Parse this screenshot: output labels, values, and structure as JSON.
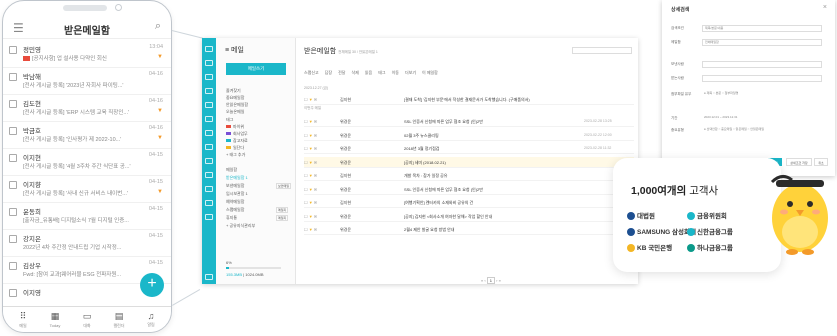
{
  "phone": {
    "title": "받은메일함",
    "menu_icon": "menu-icon",
    "items": [
      {
        "name": "정민영",
        "date": "13:04",
        "subject": "[공지사항] 업 설사용 다약인 회신",
        "flag": "red"
      },
      {
        "name": "박남해",
        "date": "04-16",
        "subject": "[전사 게시글 등록] '2023년 자회사 파이팅...'",
        "flag": "none"
      },
      {
        "name": "김도현",
        "date": "04-16",
        "subject": "[전사 게시글 등록] 'ERP 시스템 교육 직장인...'",
        "flag": "orange"
      },
      {
        "name": "박금호",
        "date": "04-16",
        "subject": "[전사 게시글 등록] '인사평가 제 2022-10...'",
        "flag": "orange"
      },
      {
        "name": "이지현",
        "date": "04-15",
        "subject": "[전사 게시글 등록] '4월 3주차 주간 식단표 공...'",
        "flag": "none"
      },
      {
        "name": "이지향",
        "date": "04-15",
        "subject": "[전사 게시글 등록] '사내 신규 서비스 내이번...'",
        "flag": "orange"
      },
      {
        "name": "윤동희",
        "date": "04-15",
        "subject": "[출자금_유통배] 디지털소식 7월 디지털 인증...",
        "flag": "none"
      },
      {
        "name": "강지은",
        "date": "04-15",
        "subject": "2022년 4차 주간정 안내드립 기업 시작정...",
        "flag": "none"
      },
      {
        "name": "김상우",
        "date": "04-15",
        "subject": "Fwd: [참여 교과]웨어러블 ESG 전파자원...",
        "flag": "none"
      },
      {
        "name": "이지영",
        "date": "04-15",
        "subject": "",
        "flag": "none"
      }
    ],
    "nav": [
      {
        "label": "메일",
        "icon": "grid-icon",
        "glyph": "⠿"
      },
      {
        "label": "Today",
        "icon": "calendar-icon",
        "glyph": "▦"
      },
      {
        "label": "대화",
        "icon": "chat-icon",
        "glyph": "▭"
      },
      {
        "label": "캘린더",
        "icon": "calendar-icon",
        "glyph": "▤"
      },
      {
        "label": "알림",
        "icon": "bell-icon",
        "glyph": "♫"
      }
    ],
    "fab_label": "+"
  },
  "desktop": {
    "app_title": "메일",
    "write_button": "메일쓰기",
    "folders": [
      {
        "label": "즐겨찾기",
        "color": ""
      },
      {
        "label": "중요메일함",
        "color": ""
      },
      {
        "label": "안읽은메일함",
        "color": ""
      },
      {
        "label": "오늘온메일",
        "color": ""
      },
      {
        "label": "태그",
        "color": ""
      },
      {
        "label": "마이위",
        "color": "#e84b3c"
      },
      {
        "label": "회사업무",
        "color": "#7a4fd6"
      },
      {
        "label": "참고자료",
        "color": "#1ab7c9"
      },
      {
        "label": "일단다",
        "color": "#f3b625"
      },
      {
        "label": "+ 태그 추가",
        "color": ""
      }
    ],
    "mailboxes": [
      {
        "label": "메일함",
        "count": ""
      },
      {
        "label": "받은메일함 1",
        "count": ""
      },
      {
        "label": "보낸메일함",
        "count": "보안메일"
      },
      {
        "label": "임시보관함 1",
        "count": ""
      },
      {
        "label": "예약메일함",
        "count": ""
      },
      {
        "label": "스팸메일함",
        "count": "메일지"
      },
      {
        "label": "휴지통",
        "count": "메일지"
      },
      {
        "label": "+ 공유지식관리부",
        "count": ""
      }
    ],
    "storage": {
      "label": "6%",
      "used": "155.3MB",
      "total": "1024.0MB"
    },
    "inbox_title": "받은메일함",
    "inbox_count": "전체메일 30 / 안읽은메일 1",
    "toolbar": [
      "스팸신고",
      "답장",
      "전달",
      "삭제",
      "읽음",
      "태그",
      "이동",
      "더보기",
      "이 메일함"
    ],
    "section_label": "2023.12.27 (금)",
    "section2": "이번주 메일",
    "rows": [
      {
        "name": "김지현",
        "subject": "[결재 도착] '김지현 부문'에서 작성한 결재문서가 도착했습니다. (구매품의서)",
        "date": "",
        "highlight": false
      },
      {
        "name": "위경윤",
        "subject": "SSL 인증서 신청에 따른 업무 협조 요청 (인)2만",
        "date": "2023-02-28 13:25",
        "highlight": false
      },
      {
        "name": "위경윤",
        "subject": "02월 3주 뉴스클리핑",
        "date": "2023-02-22 12:00",
        "highlight": false
      },
      {
        "name": "위경윤",
        "subject": "2018년 3월 정기점검",
        "date": "2023-02-28 11:32",
        "highlight": false
      },
      {
        "name": "위경윤",
        "subject": "[공지] 세미 (2018.02.21)",
        "date": "",
        "highlight": true
      },
      {
        "name": "김지현",
        "subject": "개발 목차 : 참가 일정 공유",
        "date": "",
        "highlight": false
      },
      {
        "name": "위경윤",
        "subject": "SSL 인증서 신청에 따른 업무 협조 요청 (인)2만",
        "date": "",
        "highlight": false
      },
      {
        "name": "김지현",
        "subject": "[여행기획안] 렌터카의 소재와비 공유의 건",
        "date": "",
        "highlight": false
      },
      {
        "name": "위경윤",
        "subject": "[공지] 김지현 <회사소개 여자한 달해> 작업 할인 안내",
        "date": "",
        "highlight": false
      },
      {
        "name": "위경윤",
        "subject": "2월4 제안 발굴 요청 방법 안내",
        "date": "",
        "highlight": false
      }
    ],
    "pager": {
      "prev": "« ‹",
      "current": "1",
      "next": "› »"
    }
  },
  "detail": {
    "title": "상세검색",
    "fields": [
      {
        "label": "검색조건",
        "value": "제목/본문/내용"
      },
      {
        "label": "메일함",
        "value": "전체메일함"
      },
      {
        "label": "보낸사람",
        "value": ""
      },
      {
        "label": "받는사람",
        "value": ""
      },
      {
        "label": "첨부파일 유무",
        "value": "● 제목  ○ 본문  ○ 첨부파일명"
      },
      {
        "label": "기간",
        "value": "2023.12.01 ~ 2023.12.31"
      },
      {
        "label": "중요유형",
        "value": "● 선택안함  ○ 중요메일  ○ 읽은메일  ○ 안읽은메일"
      }
    ],
    "buttons": [
      "검색",
      "상세조건 저장",
      "취소"
    ]
  },
  "card": {
    "title_num": "1,000여개의",
    "title_rest": "고객사",
    "logos": [
      {
        "name": "대법원",
        "color": "#1d4f91"
      },
      {
        "name": "금융위원회",
        "color": "#1ab7c9"
      },
      {
        "name": "SAMSUNG 삼성화재",
        "color": "#1d4f91"
      },
      {
        "name": "신한금융그룹",
        "color": "#1ab7c9"
      },
      {
        "name": "KB 국민은행",
        "color": "#f3b625"
      },
      {
        "name": "하나금융그룹",
        "color": "#0b9a8a"
      }
    ]
  }
}
